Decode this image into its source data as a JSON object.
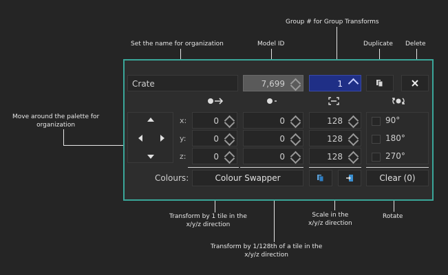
{
  "annotations": {
    "group": "Group # for Group Transforms",
    "name": "Set the name for organization",
    "model": "Model ID",
    "duplicate": "Duplicate",
    "delete": "Delete",
    "move": "Move around the palette for\norganization",
    "transform1": "Transform by 1 tile in the\nx/y/z direction",
    "transform128": "Transform by 1/128th of a tile in the\nx/y/z direction",
    "scale": "Scale in the\nx/y/z direction",
    "rotate": "Rotate"
  },
  "name_field": {
    "value": "Crate"
  },
  "model_id": {
    "value": "7,699"
  },
  "group": {
    "value": "1"
  },
  "axes": [
    "x:",
    "y:",
    "z:"
  ],
  "tile_values": [
    "0",
    "0",
    "0"
  ],
  "fine_values": [
    "0",
    "0",
    "0"
  ],
  "scale_values": [
    "128",
    "128",
    "128"
  ],
  "rotations": [
    "90°",
    "180°",
    "270°"
  ],
  "colours": {
    "label": "Colours:",
    "swapper": "Colour Swapper",
    "clear": "Clear (0)"
  }
}
